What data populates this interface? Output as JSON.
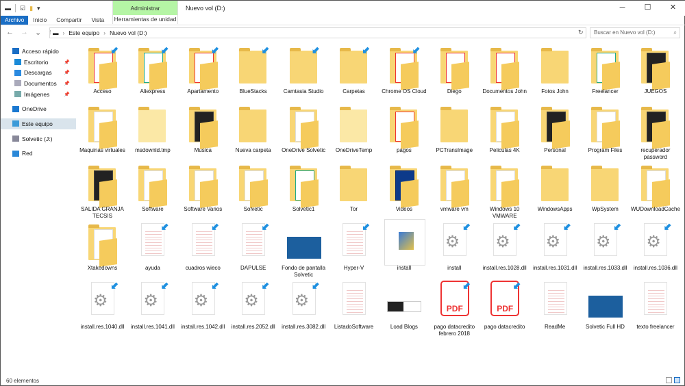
{
  "window": {
    "title": "Nuevo vol (D:)",
    "minimize": "─",
    "maximize": "☐",
    "close": "✕"
  },
  "ribbon": {
    "context_group": "Administrar",
    "context_tab": "Herramientas de unidad",
    "tabs": [
      "Archivo",
      "Inicio",
      "Compartir",
      "Vista"
    ]
  },
  "nav": {
    "back": "←",
    "forward": "→",
    "recent": "⌄",
    "up": "↑"
  },
  "address": {
    "segments": [
      "Este equipo",
      "Nuevo vol (D:)"
    ]
  },
  "search": {
    "placeholder": "Buscar en Nuevo vol (D:)"
  },
  "sidebar": {
    "items": [
      {
        "label": "Acceso rápido",
        "icon": "star-icon",
        "color": "#1a6ec5"
      },
      {
        "label": "Escritorio",
        "icon": "desktop-icon",
        "color": "#1a8ad8",
        "pinned": true,
        "indent": true
      },
      {
        "label": "Descargas",
        "icon": "download-icon",
        "color": "#2a8ae0",
        "pinned": true,
        "indent": true
      },
      {
        "label": "Documentos",
        "icon": "documents-icon",
        "color": "#aab",
        "pinned": true,
        "indent": true
      },
      {
        "label": "Imágenes",
        "icon": "pictures-icon",
        "color": "#7aa",
        "pinned": true,
        "indent": true
      },
      {
        "label": "OneDrive",
        "icon": "onedrive-icon",
        "color": "#1a78d0"
      },
      {
        "label": "Este equipo",
        "icon": "computer-icon",
        "color": "#3a9ad8",
        "selected": true
      },
      {
        "label": "Solvetic (J:)",
        "icon": "usb-drive-icon",
        "color": "#889"
      },
      {
        "label": "Red",
        "icon": "network-icon",
        "color": "#2a88d8"
      }
    ]
  },
  "files": [
    {
      "name": "Acceso",
      "type": "folder-pdf",
      "shortcut": true
    },
    {
      "name": "Aliexpress",
      "type": "folder-excel",
      "shortcut": true
    },
    {
      "name": "Apartamento",
      "type": "folder-pdf",
      "shortcut": true
    },
    {
      "name": "BlueStacks",
      "type": "folder",
      "shortcut": true
    },
    {
      "name": "Camtasia Studio",
      "type": "folder",
      "shortcut": true
    },
    {
      "name": "Carpetas",
      "type": "folder",
      "shortcut": true
    },
    {
      "name": "Chrome OS Cloud",
      "type": "folder-pdf",
      "shortcut": true
    },
    {
      "name": "Diego",
      "type": "folder-pdf"
    },
    {
      "name": "Documentos John",
      "type": "folder-pdf"
    },
    {
      "name": "Fotos John",
      "type": "folder"
    },
    {
      "name": "Freelancer",
      "type": "folder-excel"
    },
    {
      "name": "JUEGOS",
      "type": "folder-image"
    },
    {
      "name": "Maquinas virtuales",
      "type": "folder-doc"
    },
    {
      "name": "msdownld.tmp",
      "type": "folder-light"
    },
    {
      "name": "Musica",
      "type": "folder-dark"
    },
    {
      "name": "Nueva carpeta",
      "type": "folder"
    },
    {
      "name": "OneDrive Solvetic",
      "type": "folder-doc"
    },
    {
      "name": "OneDriveTemp",
      "type": "folder-light"
    },
    {
      "name": "pagos",
      "type": "folder-pdf"
    },
    {
      "name": "PCTransImage",
      "type": "folder"
    },
    {
      "name": "Peliculas 4K",
      "type": "folder-doc"
    },
    {
      "name": "Personal",
      "type": "folder-image"
    },
    {
      "name": "Program Files",
      "type": "folder-doc"
    },
    {
      "name": "recuperador password",
      "type": "folder-image"
    },
    {
      "name": "SALIDA GRANJA TECSIS",
      "type": "folder-image"
    },
    {
      "name": "Software",
      "type": "folder-doc"
    },
    {
      "name": "Software Varios",
      "type": "folder-doc"
    },
    {
      "name": "Solvetic",
      "type": "folder-doc"
    },
    {
      "name": "Solvetic1",
      "type": "folder-excel"
    },
    {
      "name": "Tor",
      "type": "folder"
    },
    {
      "name": "Videos",
      "type": "folder-blue"
    },
    {
      "name": "vmware vm",
      "type": "folder-doc"
    },
    {
      "name": "Windows 10 VMWARE",
      "type": "folder-doc"
    },
    {
      "name": "WindowsApps",
      "type": "folder"
    },
    {
      "name": "WpSystem",
      "type": "folder"
    },
    {
      "name": "WUDownloadCache",
      "type": "folder-doc"
    },
    {
      "name": "Xtakedowns",
      "type": "folder-doc"
    },
    {
      "name": "ayuda",
      "type": "doc",
      "shortcut": true
    },
    {
      "name": "cuadros wieco",
      "type": "doc",
      "shortcut": true
    },
    {
      "name": "DAPULSE",
      "type": "doc",
      "shortcut": true
    },
    {
      "name": "Fondo de pantalla Solvetic",
      "type": "image"
    },
    {
      "name": "Hyper-V",
      "type": "doc",
      "shortcut": true
    },
    {
      "name": "install",
      "type": "installer"
    },
    {
      "name": "install",
      "type": "gear-file",
      "shortcut": true
    },
    {
      "name": "install.res.1028.dll",
      "type": "dll",
      "shortcut": true
    },
    {
      "name": "install.res.1031.dll",
      "type": "dll",
      "shortcut": true
    },
    {
      "name": "install.res.1033.dll",
      "type": "dll",
      "shortcut": true
    },
    {
      "name": "install.res.1036.dll",
      "type": "dll",
      "shortcut": true
    },
    {
      "name": "install.res.1040.dll",
      "type": "dll",
      "shortcut": true
    },
    {
      "name": "install.res.1041.dll",
      "type": "dll",
      "shortcut": true
    },
    {
      "name": "install.res.1042.dll",
      "type": "dll",
      "shortcut": true
    },
    {
      "name": "install.res.2052.dll",
      "type": "dll",
      "shortcut": true
    },
    {
      "name": "install.res.3082.dll",
      "type": "dll",
      "shortcut": true
    },
    {
      "name": "ListadoSoftware",
      "type": "doc"
    },
    {
      "name": "Load Blogs",
      "type": "image-wide"
    },
    {
      "name": "pago datacredito febrero 2018",
      "type": "pdf",
      "shortcut": true,
      "badge": "PDF"
    },
    {
      "name": "pago datacredito",
      "type": "pdf",
      "shortcut": true,
      "badge": "PDF"
    },
    {
      "name": "ReadMe",
      "type": "doc"
    },
    {
      "name": "Solvetic Full HD",
      "type": "image"
    },
    {
      "name": "texto freelancer",
      "type": "doc"
    }
  ],
  "status": {
    "count": "60 elementos"
  }
}
